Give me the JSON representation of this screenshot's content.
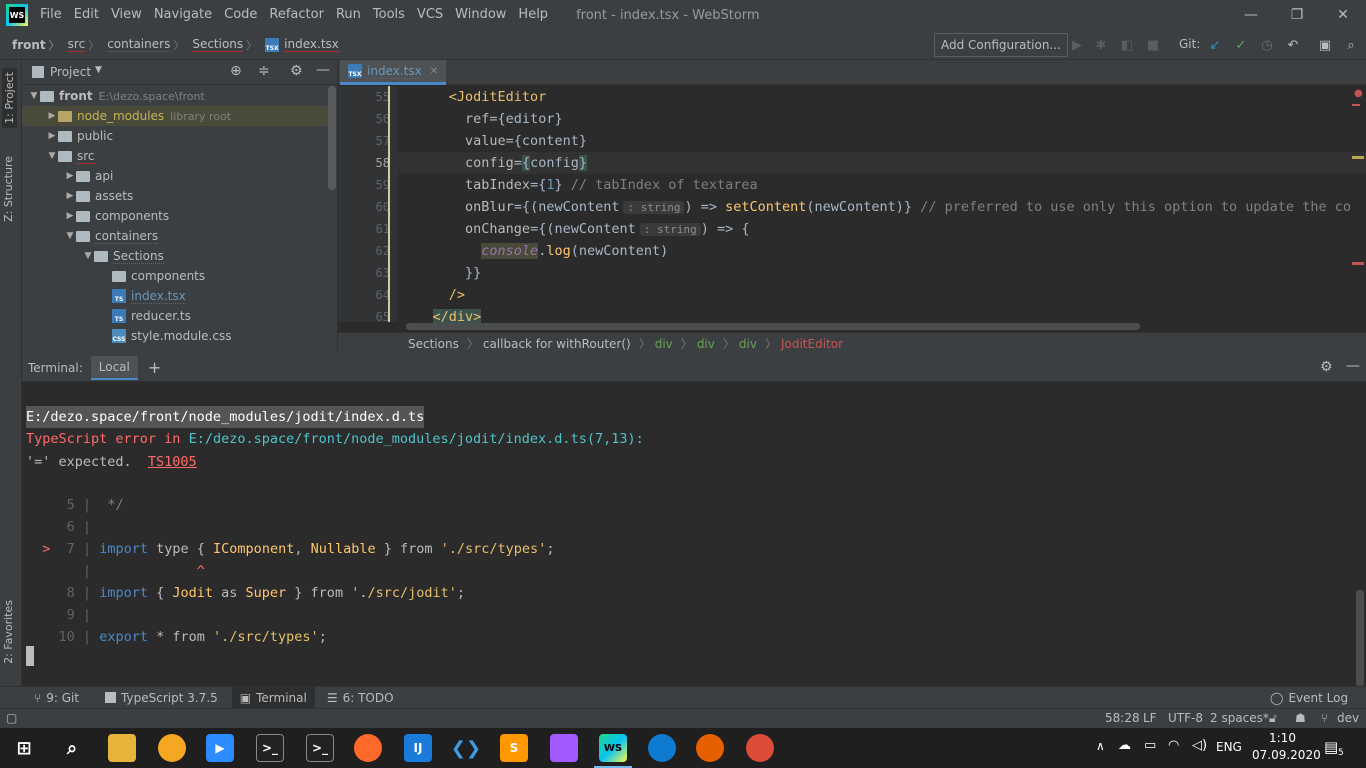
{
  "app": {
    "logo": "WS",
    "menu": [
      "File",
      "Edit",
      "View",
      "Navigate",
      "Code",
      "Refactor",
      "Run",
      "Tools",
      "VCS",
      "Window",
      "Help"
    ],
    "window_title": "front - index.tsx - WebStorm",
    "win_controls": {
      "minimize": "—",
      "maximize": "❐",
      "close": "✕"
    }
  },
  "navbar": {
    "breadcrumbs": [
      "front",
      "src",
      "containers",
      "Sections",
      "index.tsx"
    ],
    "add_config": "Add Configuration...",
    "git_label": "Git:",
    "icons": [
      "run-icon",
      "debug-icon",
      "coverage-icon",
      "stop-icon",
      "git-update-icon",
      "git-commit-icon",
      "history-icon",
      "rollback-icon",
      "layout-icon",
      "search-icon"
    ]
  },
  "left_stripe": {
    "project": "1: Project",
    "structure": "Z: Structure",
    "favorites": "2: Favorites"
  },
  "project": {
    "title": "Project",
    "tree": [
      {
        "depth": 0,
        "arrow": "▼",
        "type": "folder",
        "label": "front",
        "extra": "E:\\dezo.space\\front",
        "bold": true
      },
      {
        "depth": 1,
        "arrow": "▶",
        "type": "folder-nm",
        "label": "node_modules",
        "extra": "library root"
      },
      {
        "depth": 1,
        "arrow": "▶",
        "type": "folder",
        "label": "public",
        "extra": ""
      },
      {
        "depth": 1,
        "arrow": "▼",
        "type": "folder",
        "label": "src",
        "extra": "",
        "err": true
      },
      {
        "depth": 2,
        "arrow": "▶",
        "type": "folder",
        "label": "api",
        "extra": ""
      },
      {
        "depth": 2,
        "arrow": "▶",
        "type": "folder",
        "label": "assets",
        "extra": ""
      },
      {
        "depth": 2,
        "arrow": "▶",
        "type": "folder",
        "label": "components",
        "extra": ""
      },
      {
        "depth": 2,
        "arrow": "▼",
        "type": "folder",
        "label": "containers",
        "extra": "",
        "err": true
      },
      {
        "depth": 3,
        "arrow": "▼",
        "type": "folder",
        "label": "Sections",
        "extra": "",
        "err": true
      },
      {
        "depth": 4,
        "arrow": "",
        "type": "folder",
        "label": "components",
        "extra": ""
      },
      {
        "depth": 4,
        "arrow": "",
        "type": "ts",
        "label": "index.tsx",
        "extra": "",
        "err": true,
        "blue": true
      },
      {
        "depth": 4,
        "arrow": "",
        "type": "ts",
        "label": "reducer.ts",
        "extra": ""
      },
      {
        "depth": 4,
        "arrow": "",
        "type": "css",
        "label": "style.module.css",
        "extra": ""
      }
    ]
  },
  "editor": {
    "tab": "index.tsx",
    "line_numbers": [
      "55",
      "56",
      "57",
      "58",
      "59",
      "60",
      "61",
      "62",
      "63",
      "64",
      "65"
    ],
    "breadcrumb": [
      "Sections",
      "callback for withRouter()",
      "div",
      "div",
      "div",
      "JoditEditor"
    ]
  },
  "terminal": {
    "title": "Terminal:",
    "tab": "Local",
    "add": "+",
    "path_line": "E:/dezo.space/front/node_modules/jodit/index.d.ts",
    "error_prefix": "TypeScript error in ",
    "error_path": "E:/dezo.space/front/node_modules/jodit/index.d.ts(7,13):",
    "expected": "'=' expected.  ",
    "code": "TS1005"
  },
  "bottom_tools": {
    "git": "9: Git",
    "typescript": "TypeScript 3.7.5",
    "terminal": "Terminal",
    "todo": "6: TODO",
    "event_log": "Event Log"
  },
  "statusbar": {
    "position": "58:28",
    "line_sep": "LF",
    "encoding": "UTF-8",
    "indent": "2 spaces*",
    "branch": "dev"
  },
  "taskbar": {
    "lang": "ENG",
    "time": "1:10",
    "date": "07.09.2020",
    "notifications": "5"
  }
}
